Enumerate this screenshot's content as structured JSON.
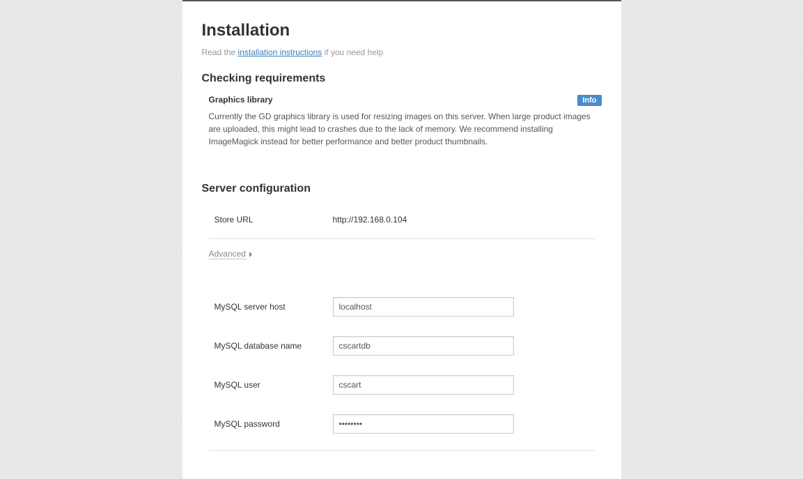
{
  "page": {
    "title": "Installation",
    "subtitle_prefix": "Read the ",
    "subtitle_link": "installation instructions",
    "subtitle_suffix": " if you need help"
  },
  "requirements": {
    "heading": "Checking requirements",
    "items": [
      {
        "title": "Graphics library",
        "badge": "Info",
        "description": "Currently the GD graphics library is used for resizing images on this server. When large product images are uploaded, this might lead to crashes due to the lack of memory. We recommend installing ImageMagick instead for better performance and better product thumbnails."
      }
    ]
  },
  "server_config": {
    "heading": "Server configuration",
    "store_url_label": "Store URL",
    "store_url_value": "http://192.168.0.104",
    "advanced_label": "Advanced",
    "fields": {
      "mysql_host_label": "MySQL server host",
      "mysql_host_value": "localhost",
      "mysql_db_label": "MySQL database name",
      "mysql_db_value": "cscartdb",
      "mysql_user_label": "MySQL user",
      "mysql_user_value": "cscart",
      "mysql_password_label": "MySQL password",
      "mysql_password_value": "••••••••"
    }
  }
}
